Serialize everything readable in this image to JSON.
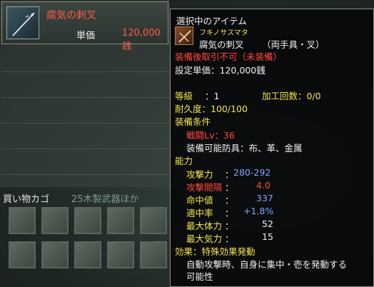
{
  "shop": {
    "item": {
      "name": "腐気の刺叉",
      "price_label": "単価",
      "price_value": "120,000銭",
      "icon": "spear-icon"
    }
  },
  "cart": {
    "header": "買い物カゴ",
    "sub": "25木製武器ほか"
  },
  "tooltip": {
    "header": "選択中のアイテム",
    "furigana": "フキノサスマタ",
    "item_name": "腐気の刺叉",
    "item_type": "（両手具・叉）",
    "restriction": "装備後取引不可（未装備）",
    "set_price": "設定単価：120,000銭",
    "grade_label": "等級",
    "grade_value": "：1",
    "process_label": "加工回数：0/0",
    "durability": "耐久度：100/100",
    "equip_condition": "装備条件",
    "level_req": "戦闘Lv：36",
    "skills": "装備可能防具：布、革、金属",
    "ability": "能力",
    "stats": [
      {
        "label": "攻撃力",
        "value": "280-292"
      },
      {
        "label": "攻撃間隔",
        "value": "4.0"
      },
      {
        "label": "命中値",
        "value": "337"
      },
      {
        "label": "適中率",
        "value": "+1.8%"
      },
      {
        "label": "最大体力",
        "value": "52"
      },
      {
        "label": "最大気力",
        "value": "15"
      }
    ],
    "effect": "効果：特殊効果発動",
    "effect_desc_1": "自動攻撃時、自身に集中・壱を発動する",
    "effect_desc_2": "可能性"
  },
  "colors": {
    "yellow": "#f2e64a",
    "red": "#ff4a3a",
    "blue": "#7fa6ff",
    "white": "#f0f0f0"
  }
}
